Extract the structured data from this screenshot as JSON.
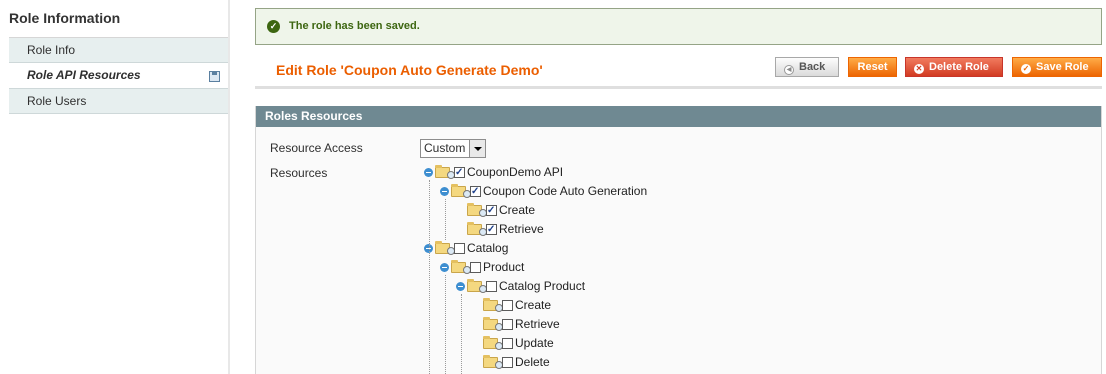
{
  "sidebar": {
    "title": "Role Information",
    "items": [
      {
        "label": "Role Info"
      },
      {
        "label": "Role API Resources"
      },
      {
        "label": "Role Users"
      }
    ]
  },
  "message": {
    "text": "The role has been saved."
  },
  "page_title": "Edit Role 'Coupon Auto Generate Demo'",
  "buttons": {
    "back": "Back",
    "reset": "Reset",
    "delete": "Delete Role",
    "save": "Save Role"
  },
  "section": {
    "title": "Roles Resources"
  },
  "form": {
    "resource_access_label": "Resource Access",
    "resource_access_value": "Custom",
    "resources_label": "Resources"
  },
  "tree": [
    {
      "label": "CouponDemo API",
      "checked": true
    },
    {
      "label": "Coupon Code Auto Generation",
      "checked": true
    },
    {
      "label": "Create",
      "checked": true
    },
    {
      "label": "Retrieve",
      "checked": true
    },
    {
      "label": "Catalog",
      "checked": false
    },
    {
      "label": "Product",
      "checked": false
    },
    {
      "label": "Catalog Product",
      "checked": false
    },
    {
      "label": "Create",
      "checked": false
    },
    {
      "label": "Retrieve",
      "checked": false
    },
    {
      "label": "Update",
      "checked": false
    },
    {
      "label": "Delete",
      "checked": false
    }
  ]
}
